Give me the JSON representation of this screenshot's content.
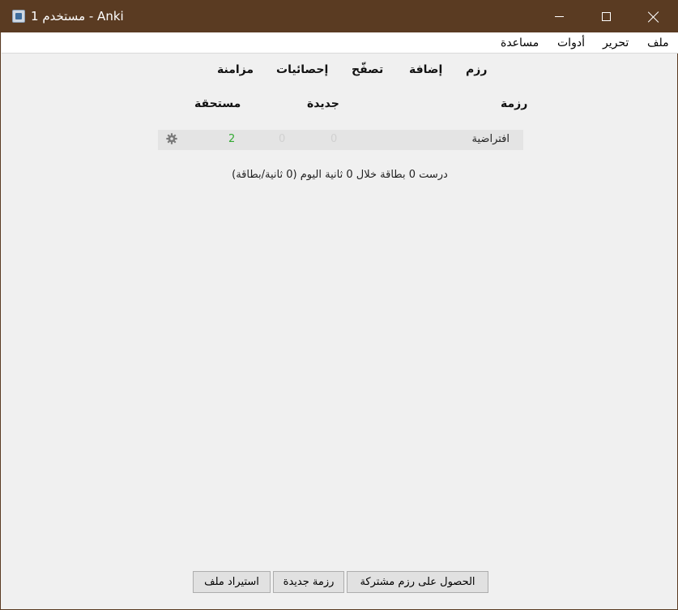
{
  "window": {
    "title": "مستخدم 1 - Anki"
  },
  "menubar": {
    "items": [
      "ملف",
      "تحرير",
      "أدوات",
      "مساعدة"
    ]
  },
  "toolbar": {
    "decks": "رزم",
    "add": "إضافة",
    "browse": "تصفّح",
    "stats": "إحصائيات",
    "sync": "مزامنة"
  },
  "deck_table": {
    "headers": {
      "deck": "رزمة",
      "new": "جديدة",
      "due": "مستحقة"
    },
    "rows": [
      {
        "name": "افتراضية",
        "due": "2",
        "learn": "0",
        "new": "0"
      }
    ]
  },
  "study_stats": "درست 0 بطاقة خلال 0 ثانية اليوم (0 ثانية/بطاقة)",
  "bottom": {
    "get_shared": "الحصول على رزم مشتركة",
    "create_deck": "رزمة جديدة",
    "import_file": "استيراد ملف"
  },
  "colors": {
    "titlebar": "#5a3b22",
    "due": "#33aa33",
    "zero": "#d0d0d0"
  },
  "icons": {
    "app": "anki-app-icon",
    "deck_options": "gear-icon"
  }
}
